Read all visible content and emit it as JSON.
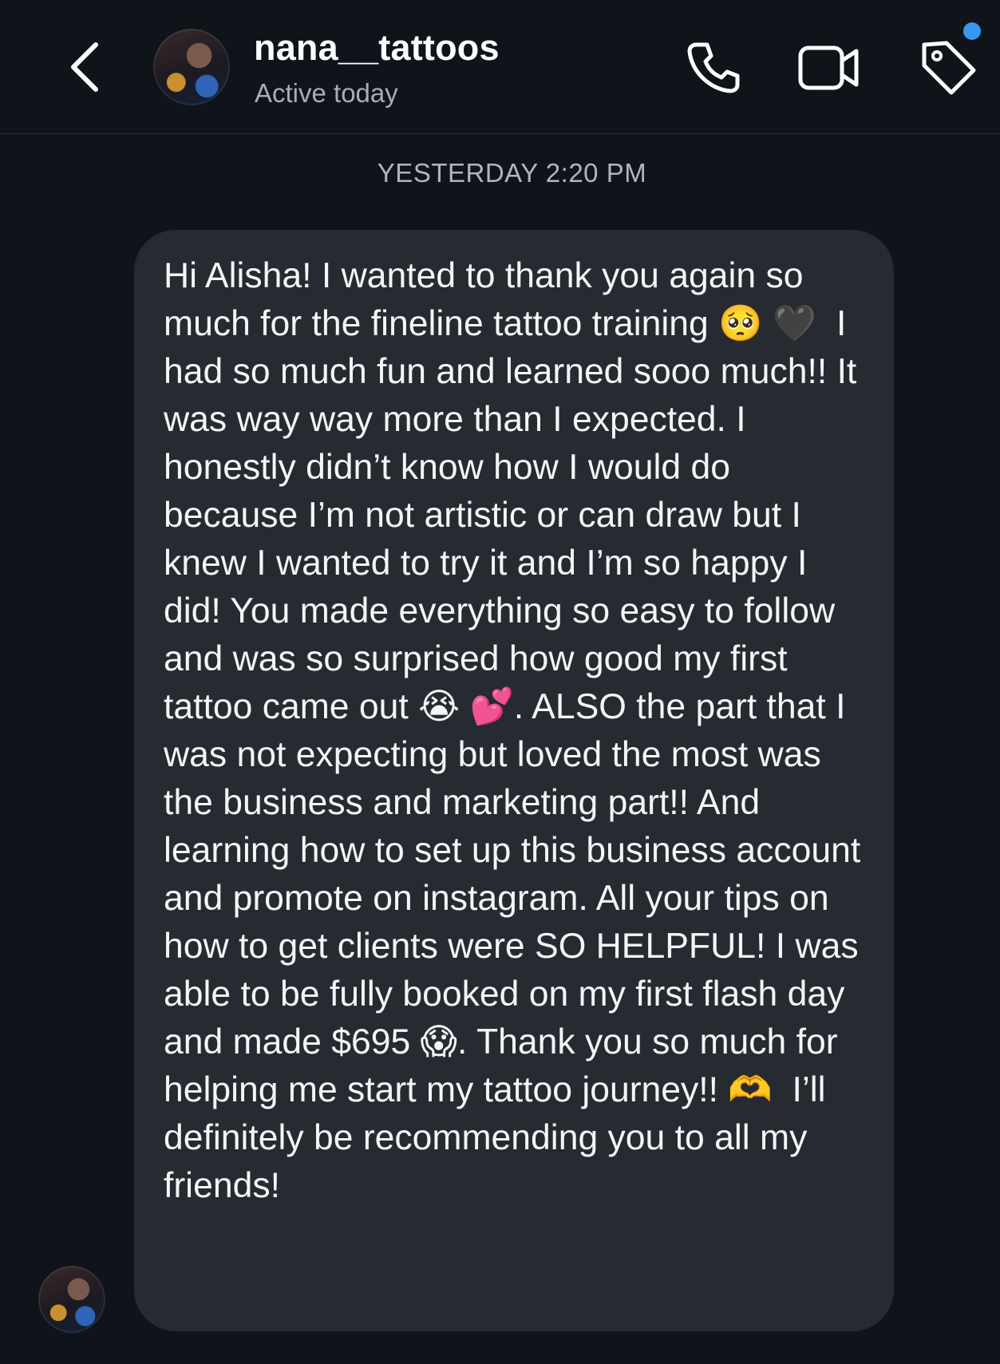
{
  "header": {
    "username": "nana__tattoos",
    "status": "Active today",
    "icons": {
      "back": "chevron-left-icon",
      "call": "phone-icon",
      "video": "video-camera-icon",
      "tag": "tag-icon"
    },
    "notification_color": "#3897f0"
  },
  "thread": {
    "timestamp": "YESTERDAY 2:20 PM",
    "message": "Hi Alisha! I wanted to thank you again so much for the fineline tattoo training 🥺 🖤  I had so much fun and learned sooo much!! It was way way more than I expected. I honestly didn’t know how I would do because I’m not artistic or can draw but I knew I wanted to try it and I’m so happy I did! You made everything so easy to follow and was so surprised how good my first tattoo came out 😭 💕. ALSO the part that I was not expecting but loved the most was the business and marketing part!! And learning how to set up this business account and promote on instagram. All your tips on how to get clients were SO HELPFUL! I was able to be fully booked on my first flash day and made $695 😱. Thank you so much for helping me start my tattoo journey!! 🫶  I’ll definitely be recommending you to all my friends!"
  },
  "colors": {
    "background": "#0f131a",
    "bubble": "#262a31",
    "secondary_text": "#a8adb5"
  }
}
